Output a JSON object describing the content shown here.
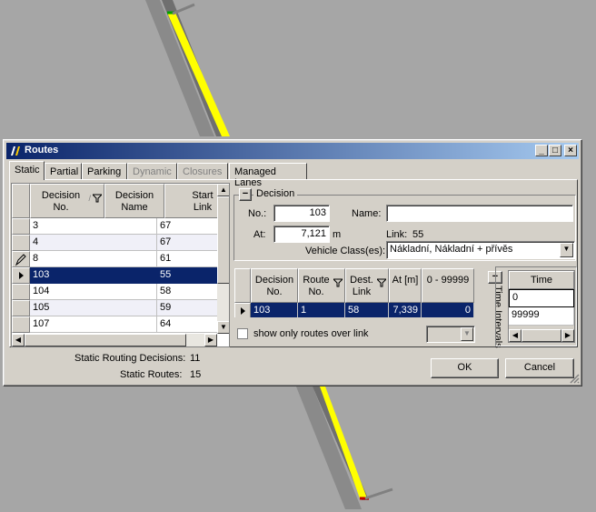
{
  "window": {
    "title": "Routes"
  },
  "tabs": [
    {
      "label": "Static",
      "active": true
    },
    {
      "label": "Partial"
    },
    {
      "label": "Parking"
    },
    {
      "label": "Dynamic",
      "disabled": true
    },
    {
      "label": "Closures",
      "disabled": true
    },
    {
      "label": "Managed Lanes"
    }
  ],
  "decisions_grid": {
    "columns": [
      "Decision No.",
      "Decision Name",
      "Start Link"
    ],
    "rows": [
      {
        "no": "3",
        "name": "",
        "start": "67"
      },
      {
        "no": "4",
        "name": "",
        "start": "67"
      },
      {
        "no": "8",
        "name": "",
        "start": "61"
      },
      {
        "no": "103",
        "name": "",
        "start": "55"
      },
      {
        "no": "104",
        "name": "",
        "start": "58"
      },
      {
        "no": "105",
        "name": "",
        "start": "59"
      },
      {
        "no": "107",
        "name": "",
        "start": "64"
      }
    ]
  },
  "decision_group": {
    "title": "Decision",
    "collapse_symbol": "−",
    "no_label": "No.:",
    "no_value": "103",
    "name_label": "Name:",
    "name_value": "",
    "at_label": "At:",
    "at_value": "7,121",
    "at_unit": "m",
    "link_label": "Link:",
    "link_value": "55",
    "vehicle_class_label": "Vehicle Class(es):",
    "vehicle_class_value": "Nákladní, Nákladní + přívěs"
  },
  "routes_grid": {
    "columns": [
      "Decision No.",
      "Route No.",
      "Dest. Link",
      "At [m]",
      "0 - 99999"
    ],
    "rows": [
      {
        "decision": "103",
        "route": "1",
        "dest": "58",
        "at": "7,339",
        "flow": "0"
      }
    ]
  },
  "time_intervals": {
    "label": "Time Intervals",
    "header": "Time",
    "values": [
      "0",
      "99999"
    ]
  },
  "show_only_routes_label": "show only routes over link",
  "status": {
    "static_decisions_label": "Static Routing Decisions:",
    "static_decisions_value": "11",
    "static_routes_label": "Static Routes:",
    "static_routes_value": "15"
  },
  "buttons": {
    "ok": "OK",
    "cancel": "Cancel"
  },
  "colors": {
    "road": "#6f6f6f",
    "road_center": "#ffff00",
    "title_start": "#0a246a",
    "selection": "#0a246a"
  }
}
